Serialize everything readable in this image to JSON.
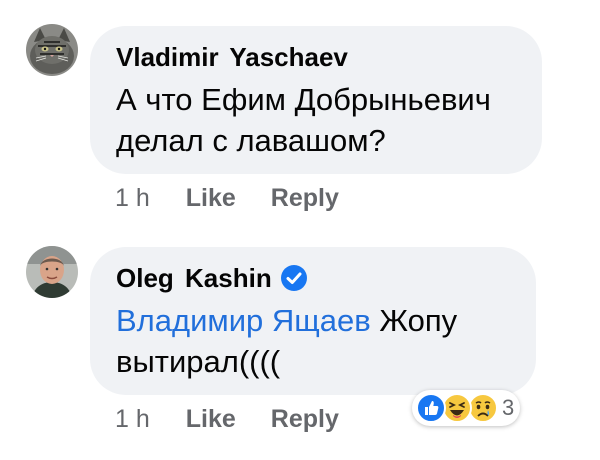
{
  "comments": [
    {
      "author": "Vladimir  Yaschaev",
      "text": "А что Ефим Добрыньевич делал с лавашом?",
      "time": "1 h",
      "like": "Like",
      "reply": "Reply"
    },
    {
      "author": "Oleg Kashin",
      "verified": true,
      "mention": "Владимир Ящаев",
      "text": " Жопу вытирал((((",
      "time": "1 h",
      "like": "Like",
      "reply": "Reply",
      "reactions": {
        "icons": [
          "like-icon",
          "haha-icon",
          "sad-icon"
        ],
        "count": "3"
      }
    }
  ],
  "colors": {
    "bubble": "#f0f2f5",
    "mention": "#216fdb",
    "meta": "#65676b",
    "verified": "#1877f2"
  }
}
